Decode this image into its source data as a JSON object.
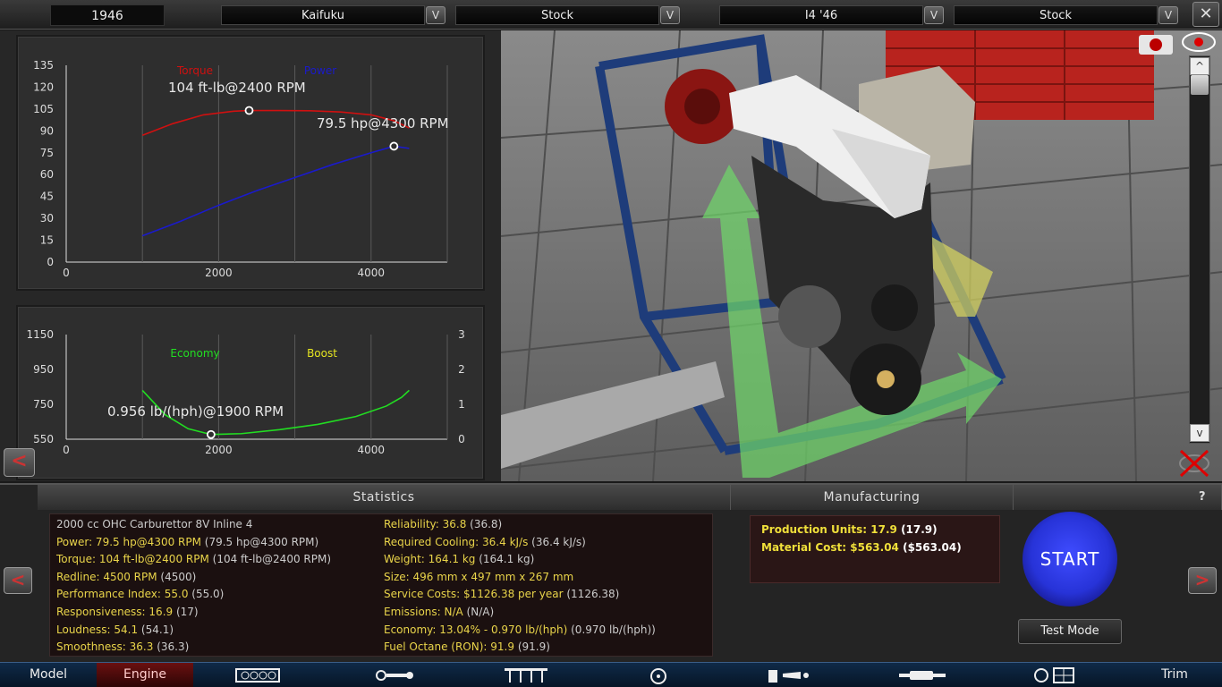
{
  "topbar": {
    "year": "1946",
    "family_name": "Kaifuku",
    "family_variant": "Stock",
    "engine_name": "I4 '46",
    "engine_variant": "Stock",
    "dropdown_glyph": "V",
    "close_glyph": "✕"
  },
  "torque_chart": {
    "chart_data": {
      "type": "line",
      "x_ticks": [
        "0",
        "2000",
        "4000"
      ],
      "y_ticks": [
        "0",
        "15",
        "30",
        "45",
        "60",
        "75",
        "90",
        "105",
        "120",
        "135"
      ],
      "xlim": [
        0,
        5000
      ],
      "ylim": [
        0,
        135
      ],
      "series": [
        {
          "name": "Torque",
          "color": "#d01010",
          "x": [
            1000,
            1400,
            1800,
            2200,
            2400,
            2800,
            3200,
            3600,
            4000,
            4300,
            4500
          ],
          "values": [
            87,
            95,
            101,
            103.5,
            104,
            104,
            103.8,
            103,
            101,
            97,
            92
          ]
        },
        {
          "name": "Power",
          "color": "#1a1acc",
          "x": [
            1000,
            1500,
            2000,
            2500,
            3000,
            3500,
            4000,
            4300,
            4500
          ],
          "values": [
            18,
            28,
            39,
            49,
            58,
            67,
            75,
            79.5,
            78
          ]
        }
      ],
      "peak_points": [
        {
          "x": 2400,
          "y": 104,
          "label": "104 ft-lb@2400 RPM"
        },
        {
          "x": 4300,
          "y": 79.5,
          "label": "79.5 hp@4300 RPM"
        }
      ],
      "grid": true
    }
  },
  "economy_chart": {
    "chart_data": {
      "type": "line",
      "x_ticks": [
        "0",
        "2000",
        "4000"
      ],
      "y_ticks_left": [
        "550",
        "750",
        "950",
        "1150"
      ],
      "y_ticks_right": [
        "0",
        "1",
        "2",
        "3"
      ],
      "xlim": [
        0,
        5000
      ],
      "ylim": [
        550,
        1150
      ],
      "series": [
        {
          "name": "Economy",
          "color": "#22dd22",
          "x": [
            1000,
            1300,
            1600,
            1900,
            2300,
            2800,
            3300,
            3800,
            4200,
            4400,
            4500
          ],
          "values": [
            830,
            690,
            610,
            577,
            582,
            605,
            635,
            680,
            740,
            790,
            830
          ]
        },
        {
          "name": "Boost",
          "color": "#e6e620",
          "x": [],
          "values": []
        }
      ],
      "peak_points": [
        {
          "x": 1900,
          "y": 577,
          "label": "0.956 lb/(hph)@1900 RPM"
        }
      ],
      "grid": true
    }
  },
  "statistics": {
    "header": "Statistics",
    "left": [
      {
        "label": "2000 cc OHC Carburettor 8V Inline 4",
        "extra": ""
      },
      {
        "label": "Power: 79.5 hp@4300 RPM",
        "extra": " (79.5 hp@4300 RPM)"
      },
      {
        "label": "Torque: 104 ft-lb@2400 RPM",
        "extra": " (104 ft-lb@2400 RPM)"
      },
      {
        "label": "Redline: 4500 RPM",
        "extra": " (4500)"
      },
      {
        "label": "Performance Index: 55.0",
        "extra": " (55.0)"
      },
      {
        "label": "Responsiveness: 16.9",
        "extra": " (17)"
      },
      {
        "label": "Loudness: 54.1",
        "extra": " (54.1)"
      },
      {
        "label": "Smoothness: 36.3",
        "extra": " (36.3)"
      }
    ],
    "right": [
      {
        "label": "Reliability: 36.8",
        "extra": " (36.8)"
      },
      {
        "label": "Required Cooling: 36.4 kJ/s",
        "extra": " (36.4 kJ/s)"
      },
      {
        "label": "Weight: 164.1 kg",
        "extra": " (164.1 kg)"
      },
      {
        "label": "Size: 496 mm x 497 mm x 267 mm",
        "extra": ""
      },
      {
        "label": "Service Costs: $1126.38 per year",
        "extra": " (1126.38)"
      },
      {
        "label": "Emissions: N/A",
        "extra": " (N/A)"
      },
      {
        "label": "Economy: 13.04% - 0.970 lb/(hph)",
        "extra": " (0.970 lb/(hph))"
      },
      {
        "label": "Fuel Octane (RON): 91.9",
        "extra": " (91.9)"
      }
    ]
  },
  "manufacturing": {
    "header": "Manufacturing",
    "production_units": "Production Units: 17.9",
    "production_units_extra": " (17.9)",
    "material_cost": "Material Cost: $563.04",
    "material_cost_extra": " ($563.04)"
  },
  "controls": {
    "start": "START",
    "test_mode": "Test Mode",
    "help": "?",
    "prev": "<",
    "next": ">",
    "back": "<",
    "scroll_up": "^",
    "scroll_down": "v"
  },
  "tabs": {
    "model": "Model",
    "engine": "Engine",
    "trim": "Trim"
  },
  "colors": {
    "accent_red": "#c03030",
    "stat_yellow": "#e9d44a",
    "start_blue": "#2733d8"
  }
}
